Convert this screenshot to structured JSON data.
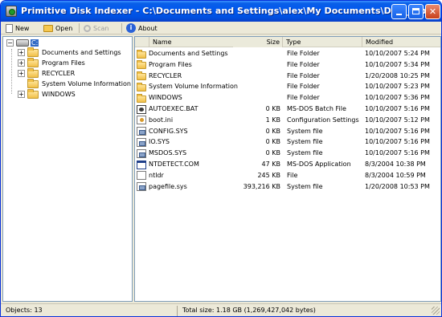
{
  "window": {
    "title": "Primitive Disk Indexer - C:\\Documents and Settings\\alex\\My Documents\\Disk_C.pdi",
    "icon": "disk-indexer-app-icon",
    "controls": [
      "minimize-icon",
      "maximize-icon",
      "close-icon"
    ]
  },
  "toolbar": {
    "new_label": "New",
    "open_label": "Open",
    "scan_label": "Scan",
    "about_label": "About",
    "icons": [
      "new-document-icon",
      "open-folder-icon",
      "magnifier-icon",
      "info-icon"
    ]
  },
  "tree": {
    "root": {
      "label": "C:",
      "icon": "drive-icon",
      "expanded": true,
      "selected": true
    },
    "children": [
      {
        "label": "Documents and Settings",
        "expandable": true
      },
      {
        "label": "Program Files",
        "expandable": true
      },
      {
        "label": "RECYCLER",
        "expandable": true
      },
      {
        "label": "System Volume Information",
        "expandable": false
      },
      {
        "label": "WINDOWS",
        "expandable": true
      }
    ]
  },
  "list": {
    "columns": {
      "name": "Name",
      "size": "Size",
      "type": "Type",
      "modified": "Modified"
    },
    "rows": [
      {
        "icon": "folder",
        "name": "Documents and Settings",
        "size": "",
        "type": "File Folder",
        "modified": "10/10/2007 5:24 PM"
      },
      {
        "icon": "folder",
        "name": "Program Files",
        "size": "",
        "type": "File Folder",
        "modified": "10/10/2007 5:34 PM"
      },
      {
        "icon": "folder",
        "name": "RECYCLER",
        "size": "",
        "type": "File Folder",
        "modified": "1/20/2008 10:25 PM"
      },
      {
        "icon": "folder",
        "name": "System Volume Information",
        "size": "",
        "type": "File Folder",
        "modified": "10/10/2007 5:23 PM"
      },
      {
        "icon": "folder",
        "name": "WINDOWS",
        "size": "",
        "type": "File Folder",
        "modified": "10/10/2007 5:36 PM"
      },
      {
        "icon": "bat",
        "name": "AUTOEXEC.BAT",
        "size": "0 KB",
        "type": "MS-DOS Batch File",
        "modified": "10/10/2007 5:16 PM"
      },
      {
        "icon": "ini",
        "name": "boot.ini",
        "size": "1 KB",
        "type": "Configuration Settings",
        "modified": "10/10/2007 5:12 PM"
      },
      {
        "icon": "sys",
        "name": "CONFIG.SYS",
        "size": "0 KB",
        "type": "System file",
        "modified": "10/10/2007 5:16 PM"
      },
      {
        "icon": "sys",
        "name": "IO.SYS",
        "size": "0 KB",
        "type": "System file",
        "modified": "10/10/2007 5:16 PM"
      },
      {
        "icon": "sys",
        "name": "MSDOS.SYS",
        "size": "0 KB",
        "type": "System file",
        "modified": "10/10/2007 5:16 PM"
      },
      {
        "icon": "com",
        "name": "NTDETECT.COM",
        "size": "47 KB",
        "type": "MS-DOS Application",
        "modified": "8/3/2004 10:38 PM"
      },
      {
        "icon": "file",
        "name": "ntldr",
        "size": "245 KB",
        "type": "File",
        "modified": "8/3/2004 10:59 PM"
      },
      {
        "icon": "sys",
        "name": "pagefile.sys",
        "size": "393,216 KB",
        "type": "System file",
        "modified": "1/20/2008 10:53 PM"
      }
    ]
  },
  "status": {
    "objects": "Objects: 13",
    "total": "Total size: 1.18 GB (1,269,427,042 bytes)"
  },
  "colors": {
    "titlebar": "#0058ee",
    "selection": "#316ac5",
    "folder": "#f1c048",
    "window_face": "#ece9d8"
  }
}
